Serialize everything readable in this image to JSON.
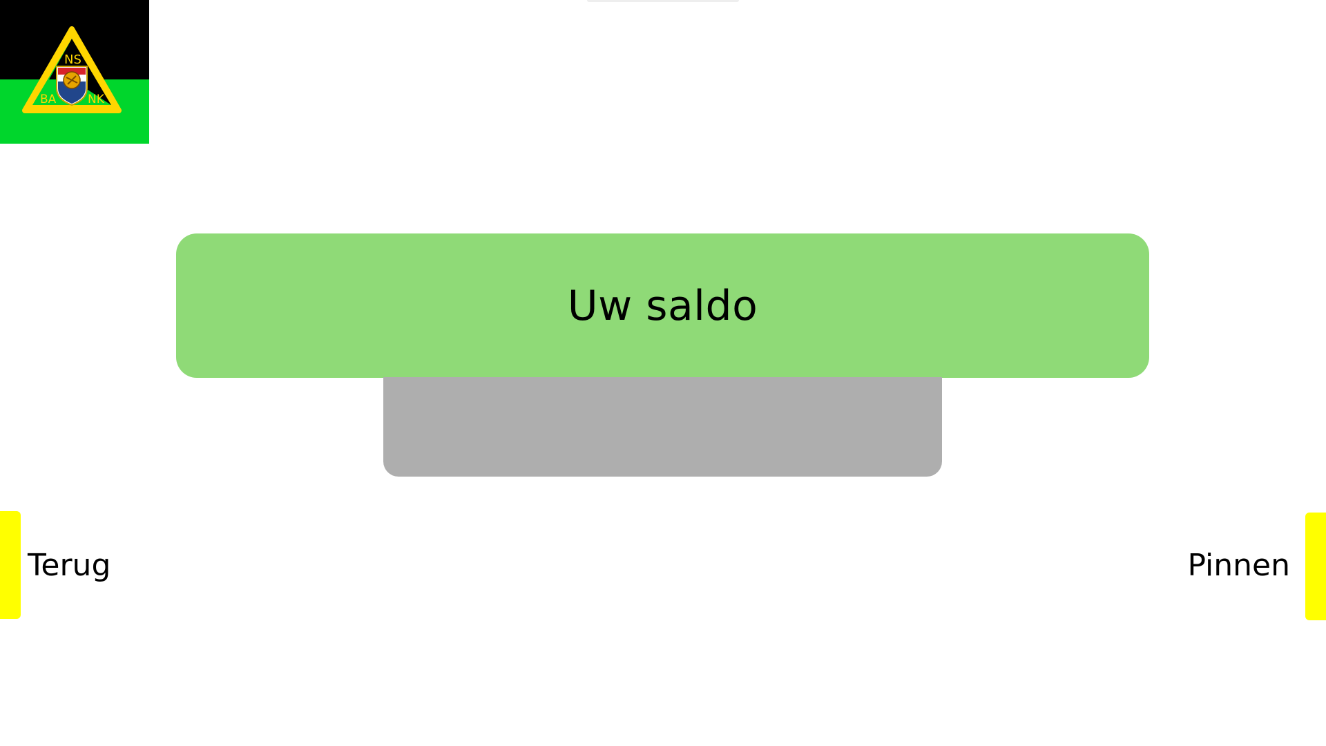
{
  "logo": {
    "text_top": "NS",
    "text_bottom_left": "BA",
    "text_bottom_right": "NK",
    "colors": {
      "band_top": "#000000",
      "band_bottom": "#00d62c",
      "triangle_border": "#ffd600"
    }
  },
  "main": {
    "title": "Uw saldo",
    "balance": ""
  },
  "actions": {
    "left_label": "Terug",
    "right_label": "Pinnen"
  },
  "colors": {
    "title_banner": "#8fda77",
    "balance_box": "#aeaeae",
    "side_buttons": "#ffff00"
  }
}
